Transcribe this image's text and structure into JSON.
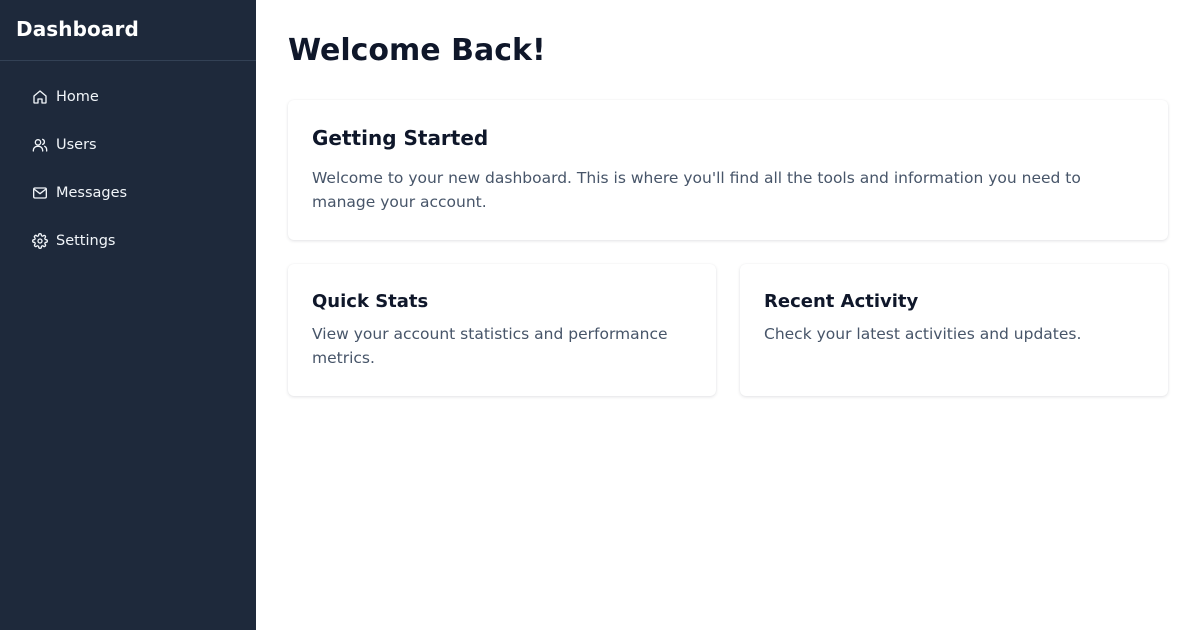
{
  "sidebar": {
    "brand": "Dashboard",
    "items": [
      {
        "label": "Home",
        "icon": "home-icon"
      },
      {
        "label": "Users",
        "icon": "users-icon"
      },
      {
        "label": "Messages",
        "icon": "mail-icon"
      },
      {
        "label": "Settings",
        "icon": "gear-icon"
      }
    ]
  },
  "main": {
    "title": "Welcome Back!",
    "getting_started": {
      "title": "Getting Started",
      "text": "Welcome to your new dashboard. This is where you'll find all the tools and information you need to manage your account."
    },
    "quick_stats": {
      "title": "Quick Stats",
      "text": "View your account statistics and performance metrics."
    },
    "recent_activity": {
      "title": "Recent Activity",
      "text": "Check your latest activities and updates."
    }
  },
  "colors": {
    "sidebar_bg": "#1e293b",
    "page_bg": "#ffffff",
    "heading": "#0f172a",
    "body_text": "#475569"
  }
}
